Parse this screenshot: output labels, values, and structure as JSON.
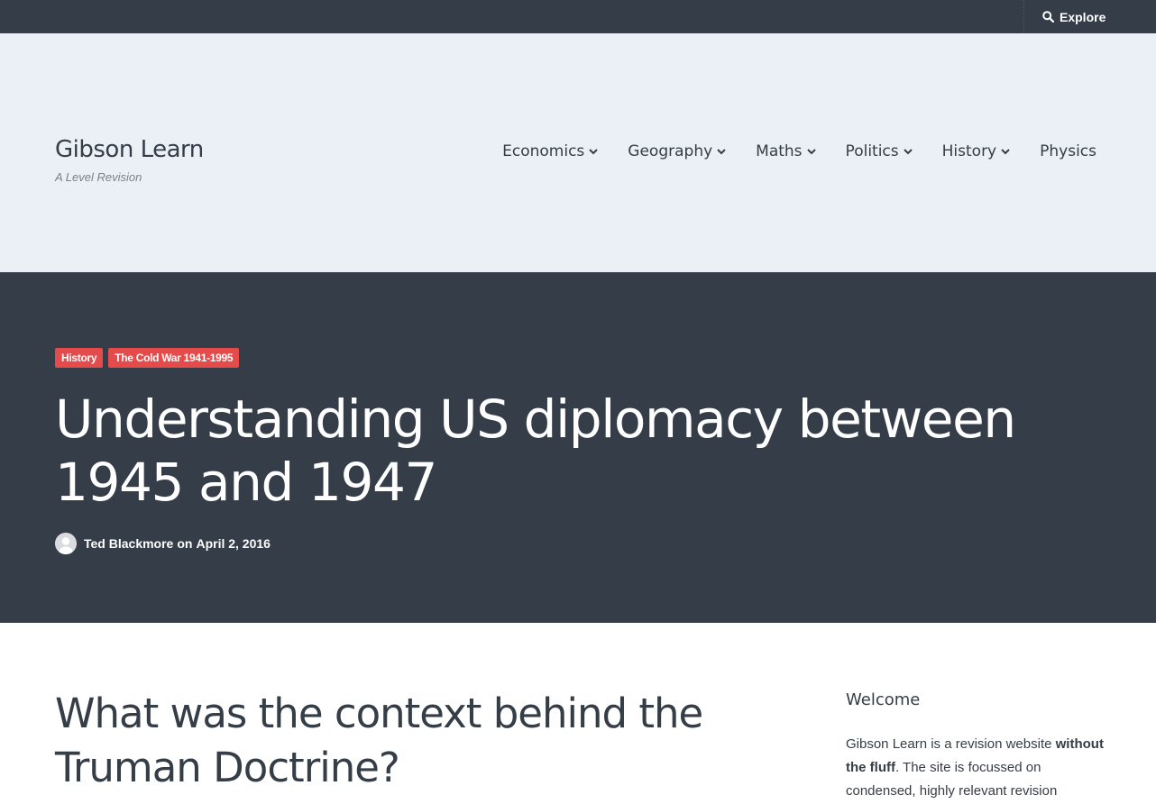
{
  "topbar": {
    "explore_label": "Explore",
    "icon": "search-icon"
  },
  "header": {
    "site_title": "Gibson Learn",
    "tagline": "A Level Revision",
    "nav": [
      {
        "label": "Economics",
        "has_dropdown": true
      },
      {
        "label": "Geography",
        "has_dropdown": true
      },
      {
        "label": "Maths",
        "has_dropdown": true
      },
      {
        "label": "Politics",
        "has_dropdown": true
      },
      {
        "label": "History",
        "has_dropdown": true
      },
      {
        "label": "Physics",
        "has_dropdown": false
      }
    ]
  },
  "hero": {
    "tags": [
      "History",
      "The Cold War 1941-1995"
    ],
    "title": "Understanding US diplomacy between 1945 and 1947",
    "author": "Ted Blackmore",
    "on": "on",
    "date": "April 2, 2016"
  },
  "article": {
    "heading": "What was the context behind the Truman Doctrine?"
  },
  "sidebar": {
    "title": "Welcome",
    "text_before": "Gibson Learn is a revision website ",
    "text_bold": "without the fluff",
    "text_after": ". The site is focussed on condensed, highly relevant revision"
  },
  "colors": {
    "dark": "#343d48",
    "header_bg": "#ebf0f7",
    "tag": "#e54b4b",
    "text": "#353d47"
  }
}
